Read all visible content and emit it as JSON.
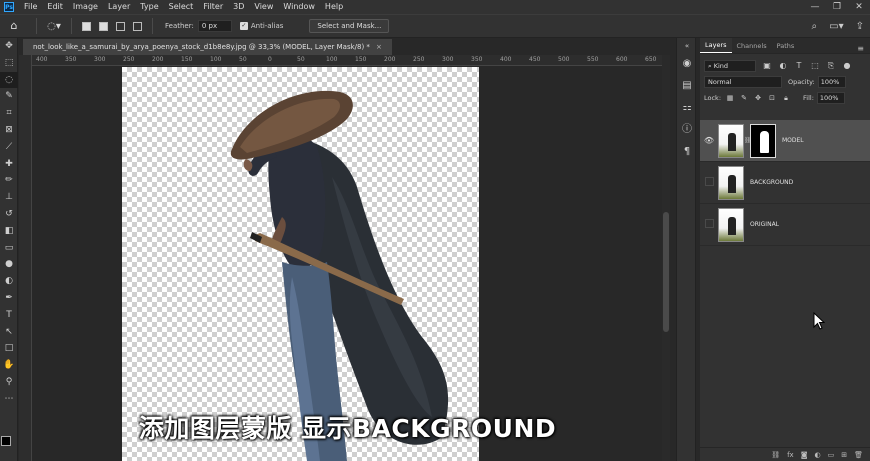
{
  "menubar": {
    "logo": "Ps",
    "items": [
      "File",
      "Edit",
      "Image",
      "Layer",
      "Type",
      "Select",
      "Filter",
      "3D",
      "View",
      "Window",
      "Help"
    ],
    "window_controls": [
      "—",
      "❐",
      "✕"
    ]
  },
  "options": {
    "feather_label": "Feather:",
    "feather_value": "0 px",
    "antialias_label": "Anti-alias",
    "select_mask_label": "Select and Mask..."
  },
  "document": {
    "tab_title": "not_look_like_a_samurai_by_arya_poenya_stock_d1b8e8y.jpg @ 33,3% (MODEL, Layer Mask/8) *",
    "close": "×",
    "ruler_labels": [
      "400",
      "350",
      "300",
      "250",
      "200",
      "150",
      "100",
      "50",
      "0",
      "50",
      "100",
      "150",
      "200",
      "250",
      "300",
      "350",
      "400",
      "450",
      "500",
      "550",
      "600",
      "650"
    ]
  },
  "subtitle": "添加图层蒙版 显示BACKGROUND",
  "panel": {
    "tabs": [
      "Layers",
      "Channels",
      "Paths"
    ],
    "active_tab": "Layers",
    "kind_label": "Kind",
    "blend_mode": "Normal",
    "opacity_label": "Opacity:",
    "opacity_value": "100%",
    "lock_label": "Lock:",
    "fill_label": "Fill:",
    "fill_value": "100%",
    "layers": [
      {
        "name": "MODEL",
        "visible": true,
        "selected": true,
        "has_mask": true
      },
      {
        "name": "BACKGROUND",
        "visible": false,
        "selected": false,
        "has_mask": false
      },
      {
        "name": "ORIGINAL",
        "visible": false,
        "selected": false,
        "has_mask": false
      }
    ]
  },
  "colors": {
    "accent": "#31a8ff",
    "foreground_swatch": "#000000",
    "background_swatch": "#ffffff"
  }
}
